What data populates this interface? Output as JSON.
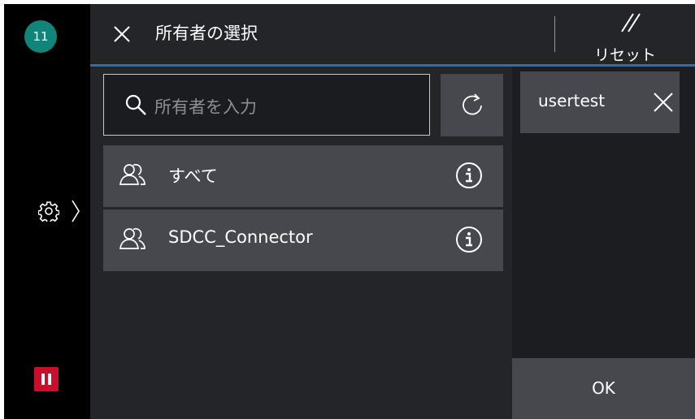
{
  "status": {
    "badge_count": "11"
  },
  "header": {
    "title": "所有者の選択",
    "reset_label": "リセット"
  },
  "search": {
    "placeholder": "所有者を入力"
  },
  "list": {
    "items": [
      {
        "label": "すべて",
        "icon": "group-icon"
      },
      {
        "label": "SDCC_Connector",
        "icon": "group-icon"
      }
    ]
  },
  "selected": {
    "chip_label": "usertest"
  },
  "actions": {
    "ok_label": "OK"
  },
  "colors": {
    "accent": "#1b72c4",
    "badge": "#12857a",
    "pause": "#c8102e",
    "panel": "#46484e"
  }
}
